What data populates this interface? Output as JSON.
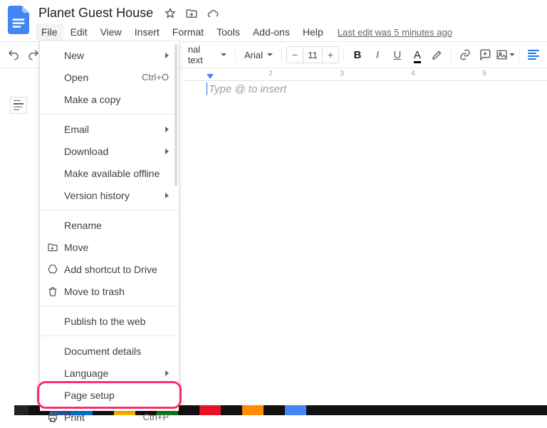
{
  "header": {
    "doc_title": "Planet Guest House",
    "last_edit": "Last edit was 5 minutes ago"
  },
  "menubar": {
    "items": [
      "File",
      "Edit",
      "View",
      "Insert",
      "Format",
      "Tools",
      "Add-ons",
      "Help"
    ],
    "active_index": 0
  },
  "toolbar": {
    "style_select": "nal text",
    "font_select": "Arial",
    "font_size": "11"
  },
  "ruler": {
    "ticks": [
      "2",
      "3",
      "4",
      "5"
    ]
  },
  "page": {
    "placeholder": "Type @ to insert"
  },
  "file_menu": {
    "groups": [
      [
        {
          "label": "New",
          "submenu": true
        },
        {
          "label": "Open",
          "shortcut": "Ctrl+O"
        },
        {
          "label": "Make a copy"
        }
      ],
      [
        {
          "label": "Email",
          "submenu": true
        },
        {
          "label": "Download",
          "submenu": true
        },
        {
          "label": "Make available offline"
        },
        {
          "label": "Version history",
          "submenu": true
        }
      ],
      [
        {
          "label": "Rename"
        },
        {
          "label": "Move",
          "icon": "move"
        },
        {
          "label": "Add shortcut to Drive",
          "icon": "shortcut"
        },
        {
          "label": "Move to trash",
          "icon": "trash"
        }
      ],
      [
        {
          "label": "Publish to the web"
        }
      ],
      [
        {
          "label": "Document details"
        },
        {
          "label": "Language",
          "submenu": true
        },
        {
          "label": "Page setup",
          "highlighted": true
        },
        {
          "label": "Print",
          "icon": "print",
          "shortcut": "Ctrl+P"
        }
      ]
    ]
  }
}
